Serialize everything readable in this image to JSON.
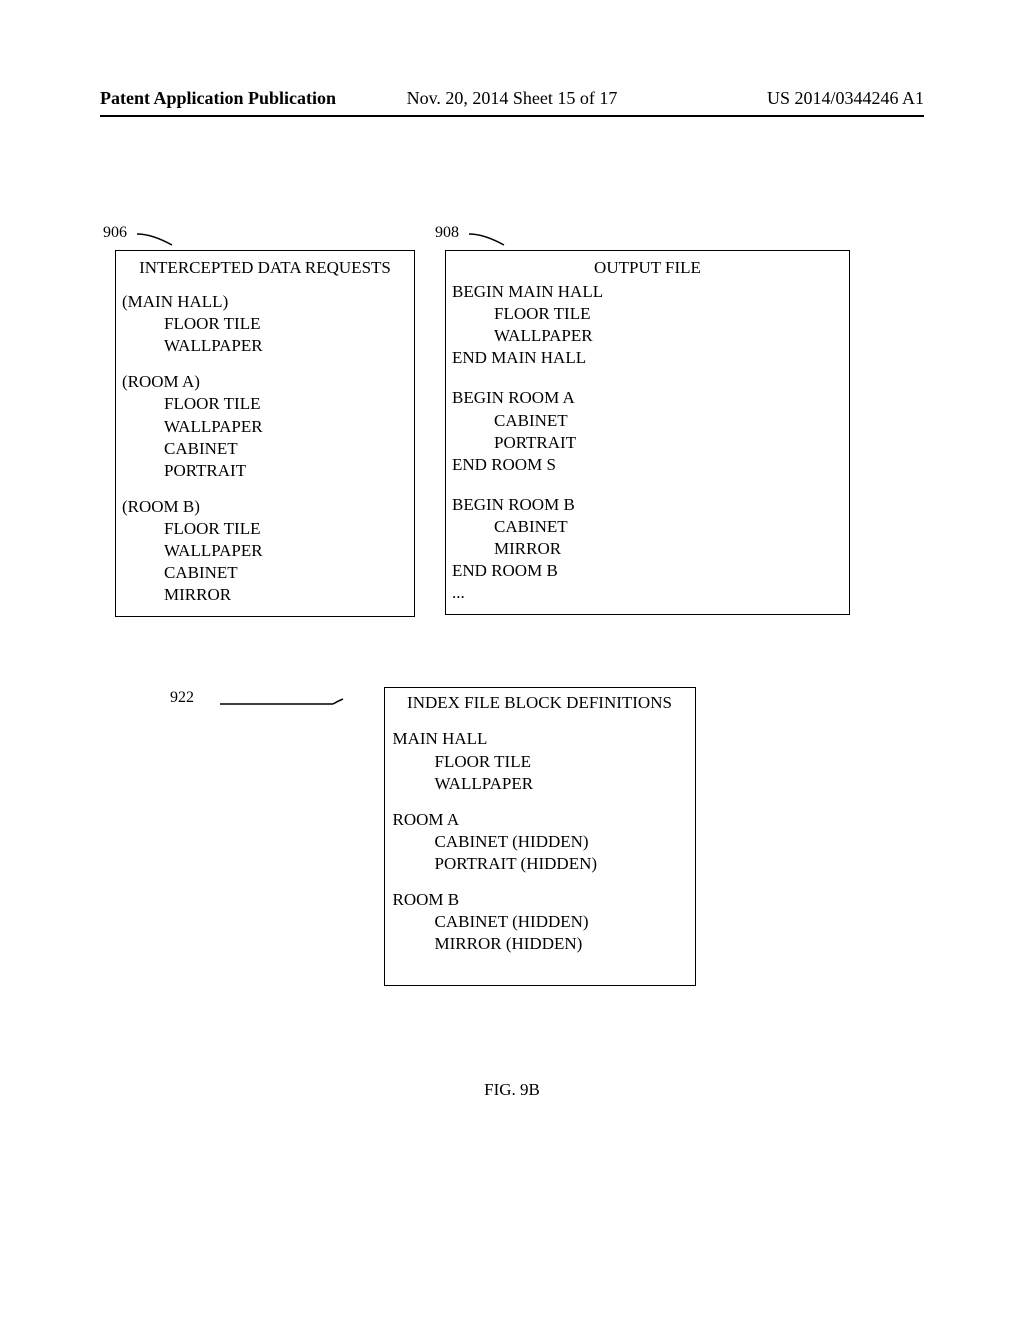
{
  "header": {
    "left": "Patent Application Publication",
    "center": "Nov. 20, 2014  Sheet 15 of 17",
    "right": "US 2014/0344246 A1"
  },
  "callouts": {
    "c906": "906",
    "c908": "908",
    "c922": "922"
  },
  "box906": {
    "title": "INTERCEPTED DATA REQUESTS",
    "groups": [
      {
        "header": "(MAIN HALL)",
        "items": [
          "FLOOR TILE",
          "WALLPAPER"
        ]
      },
      {
        "header": "(ROOM A)",
        "items": [
          "FLOOR TILE",
          "WALLPAPER",
          "CABINET",
          "PORTRAIT"
        ]
      },
      {
        "header": "(ROOM B)",
        "items": [
          "FLOOR TILE",
          "WALLPAPER",
          "CABINET",
          "MIRROR"
        ]
      }
    ]
  },
  "box908": {
    "title": "OUTPUT FILE",
    "lines": [
      {
        "text": "BEGIN MAIN HALL",
        "indent": false
      },
      {
        "text": "FLOOR TILE",
        "indent": true
      },
      {
        "text": "WALLPAPER",
        "indent": true
      },
      {
        "text": "END MAIN HALL",
        "indent": false
      },
      {
        "text": "",
        "indent": false
      },
      {
        "text": "BEGIN ROOM A",
        "indent": false
      },
      {
        "text": "CABINET",
        "indent": true
      },
      {
        "text": "PORTRAIT",
        "indent": true
      },
      {
        "text": "END ROOM S",
        "indent": false
      },
      {
        "text": "",
        "indent": false
      },
      {
        "text": "BEGIN ROOM B",
        "indent": false
      },
      {
        "text": "CABINET",
        "indent": true
      },
      {
        "text": "MIRROR",
        "indent": true
      },
      {
        "text": "END ROOM B",
        "indent": false
      },
      {
        "text": "...",
        "indent": false
      }
    ]
  },
  "box922": {
    "title": "INDEX FILE BLOCK DEFINITIONS",
    "groups": [
      {
        "header": "MAIN HALL",
        "items": [
          "FLOOR TILE",
          "WALLPAPER"
        ]
      },
      {
        "header": "ROOM A",
        "items": [
          "CABINET (HIDDEN)",
          "PORTRAIT (HIDDEN)"
        ]
      },
      {
        "header": "ROOM B",
        "items": [
          "CABINET  (HIDDEN)",
          "MIRROR (HIDDEN)"
        ]
      }
    ]
  },
  "figure_label": "FIG. 9B"
}
